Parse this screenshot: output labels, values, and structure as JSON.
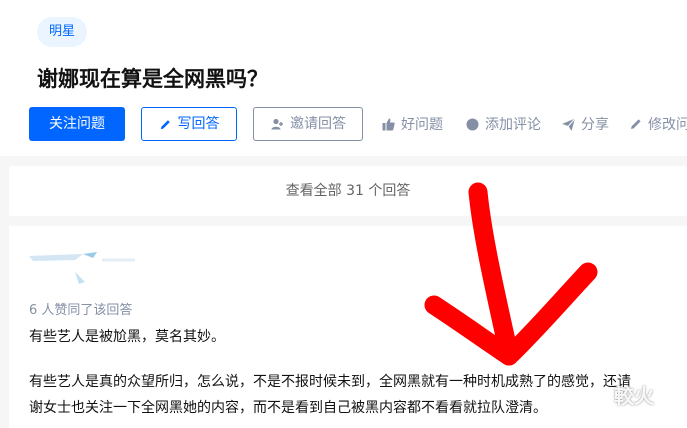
{
  "question": {
    "topic_tag": "明星",
    "title": "谢娜现在算是全网黑吗？"
  },
  "actions": {
    "follow": "关注问题",
    "write_answer": "写回答",
    "invite": "邀请回答",
    "good_question": "好问题",
    "add_comment": "添加评论",
    "share": "分享",
    "edit": "修改问"
  },
  "answers": {
    "view_all": "查看全部 31 个回答"
  },
  "answer": {
    "likes": "6 人赞同了该回答",
    "para1": "有些艺人是被尬黑，莫名其妙。",
    "para2_line1": "有些艺人是真的众望所归，怎么说，不是不报时候未到，全网黑就有一种时机成熟了的感觉，还请",
    "para2_line2": "谢女士也关注一下全网黑她的内容，而不是看到自己被黑内容都不看看就拉队澄清。"
  },
  "overlay": {
    "arrow_color": "#ff0000",
    "watermark": "較火"
  },
  "colors": {
    "brand": "#0066ff",
    "muted": "#8590a6"
  }
}
